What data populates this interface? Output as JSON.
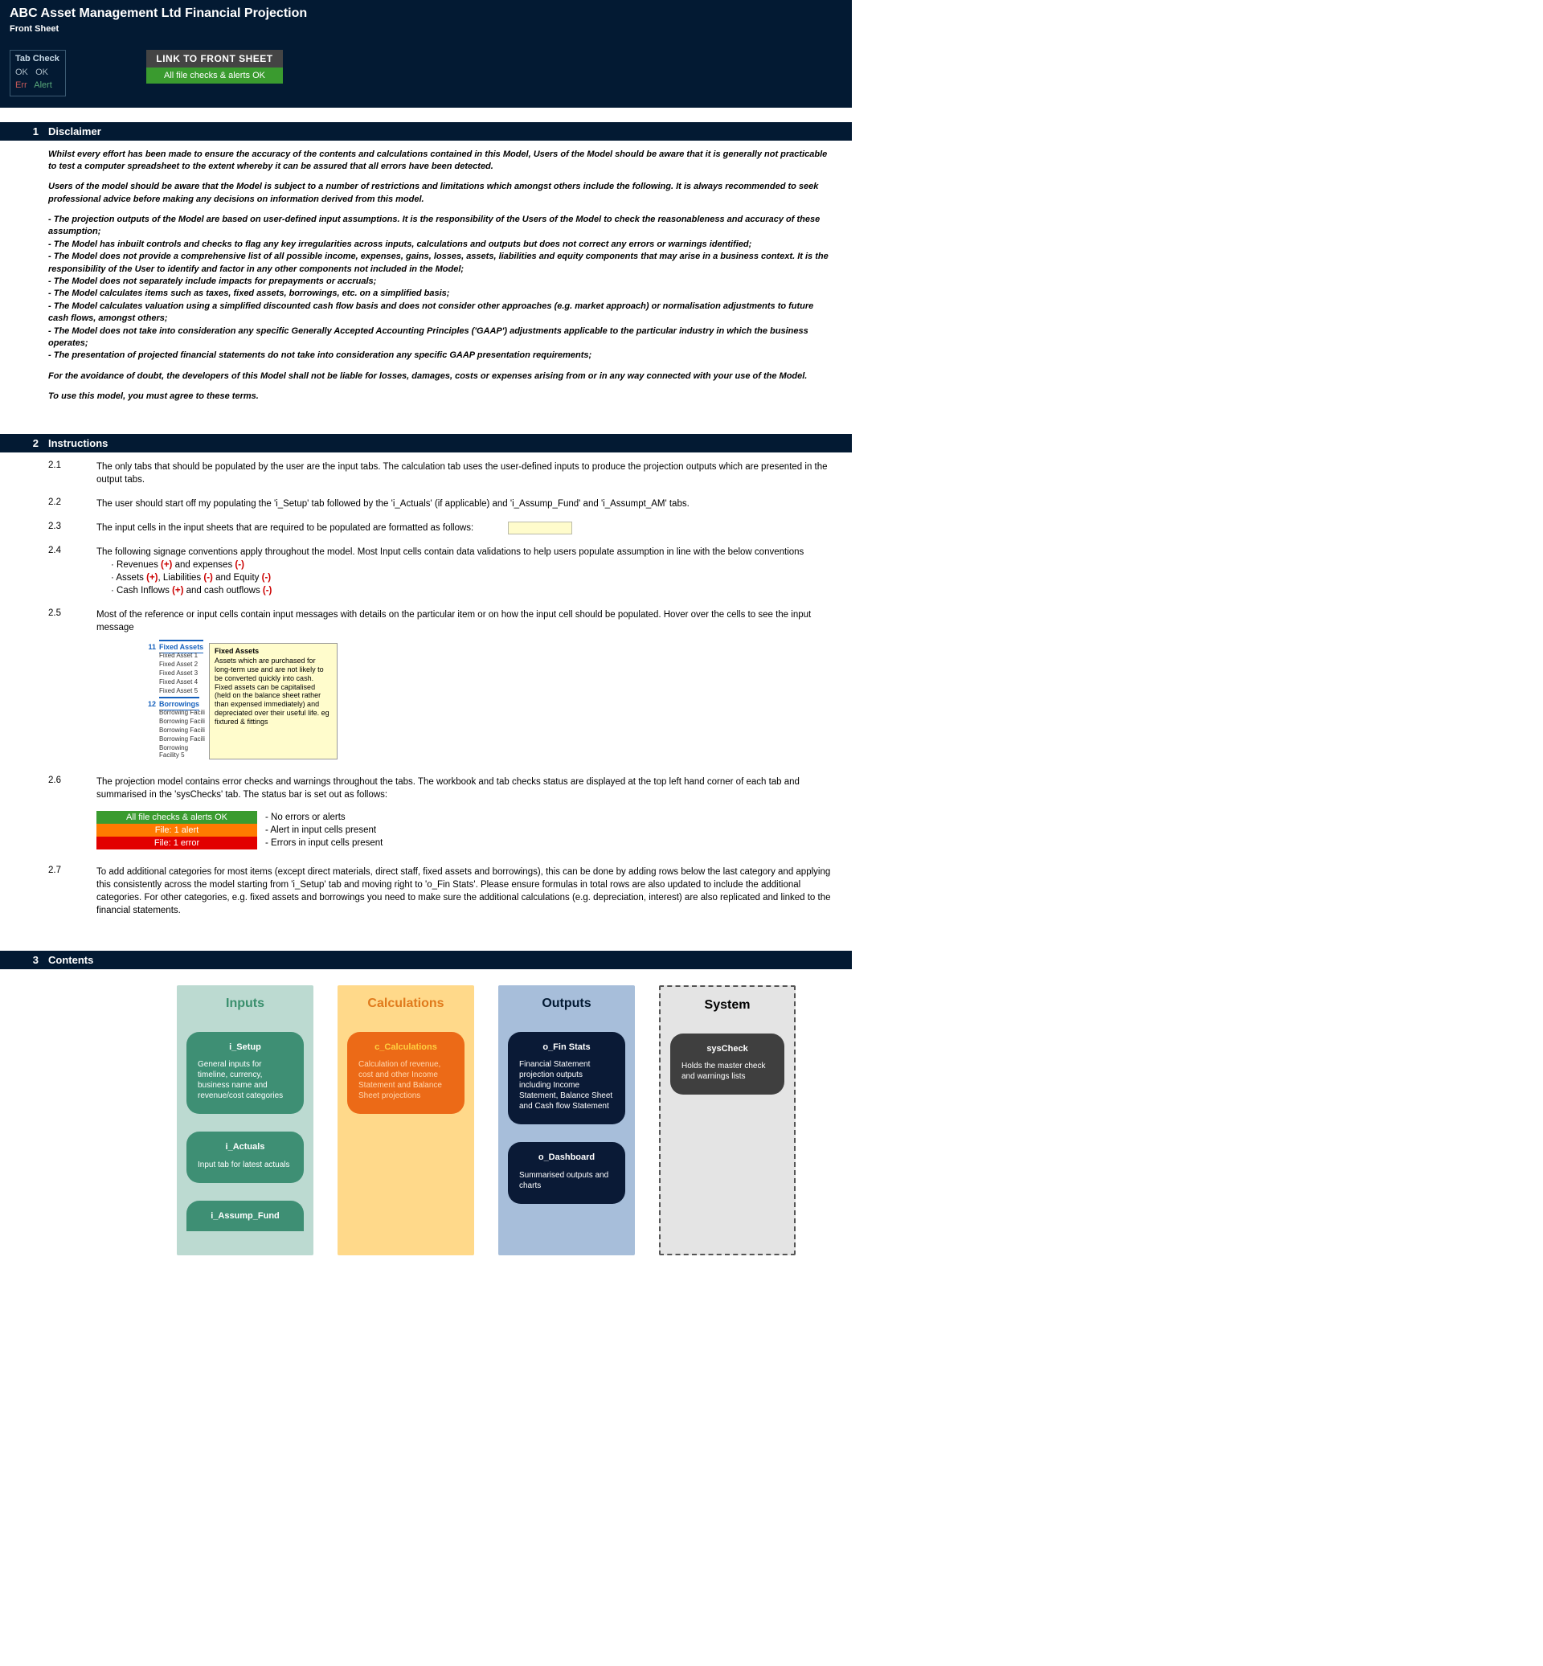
{
  "header": {
    "title": "ABC Asset Management Ltd Financial Projection",
    "subtitle": "Front Sheet",
    "tabcheck": {
      "title": "Tab Check",
      "line2a": "OK",
      "line2b": "OK",
      "line3a": "Err",
      "line3b": "Alert"
    },
    "linkbox": {
      "top": "LINK TO FRONT SHEET",
      "bottom": "All file checks & alerts OK"
    }
  },
  "sections": {
    "s1": {
      "num": "1",
      "title": "Disclaimer"
    },
    "s2": {
      "num": "2",
      "title": "Instructions"
    },
    "s3": {
      "num": "3",
      "title": "Contents"
    }
  },
  "disclaimer": {
    "p1": "Whilst every effort has been made to ensure the accuracy of the contents and calculations contained in this Model, Users of the Model should be aware that it is generally not practicable to test a computer spreadsheet to the extent whereby it can be assured that all errors have been detected.",
    "p2": "Users of the model should be aware that the Model is subject to a number of restrictions and limitations which amongst others include the following.  It is always recommended to seek professional advice before making any decisions on information derived from this model.",
    "b1": "- The projection outputs of the Model are based on user-defined input assumptions. It is the responsibility of the Users of the Model to check the reasonableness and accuracy of these assumption;",
    "b2": "- The Model has inbuilt controls and checks to flag any key irregularities across inputs, calculations and outputs but does not correct any errors or warnings identified;",
    "b3": "- The Model does not provide a comprehensive list of all possible income, expenses, gains, losses, assets, liabilities and equity components that may arise in a business context. It is the responsibility of the User to identify and factor in any other components not included in the Model;",
    "b4": "- The Model does not separately include impacts for prepayments or accruals;",
    "b5": "- The Model calculates items such as taxes, fixed assets, borrowings, etc. on a simplified basis;",
    "b6": "- The Model calculates valuation using a simplified discounted cash flow basis and does not consider other approaches (e.g. market approach) or normalisation adjustments to future cash flows, amongst others;",
    "b7": "- The Model does not take into consideration any specific Generally Accepted Accounting Principles ('GAAP') adjustments applicable to the particular industry in which the business operates;",
    "b8": "- The presentation of projected financial statements do not take into consideration any specific GAAP presentation requirements;",
    "p3": "For the avoidance of doubt, the developers of this Model shall not be liable for losses, damages, costs or expenses arising from or in any way connected with your use of the Model.",
    "p4": "To use this model, you must agree to these terms."
  },
  "instructions": {
    "i21": {
      "n": "2.1",
      "t": "The only tabs that should be populated by the user are the input tabs. The calculation tab uses the user-defined inputs to produce the projection outputs which are presented in the output tabs."
    },
    "i22": {
      "n": "2.2",
      "t": "The user should start off my populating the 'i_Setup' tab followed by the 'i_Actuals' (if applicable) and 'i_Assump_Fund' and 'i_Assumpt_AM' tabs."
    },
    "i23": {
      "n": "2.3",
      "t": "The input cells in the input sheets that are required to be populated are formatted as follows:"
    },
    "i24": {
      "n": "2.4",
      "t": "The following signage conventions apply throughout the model. Most Input cells contain data validations to help users populate assumption in line with the below conventions"
    },
    "sign": {
      "l1a": "Revenues ",
      "l1b": "(+)",
      "l1c": " and expenses ",
      "l1d": "(-)",
      "l2a": "Assets ",
      "l2b": "(+)",
      "l2c": ", Liabilities ",
      "l2d": "(-)",
      "l2e": " and Equity ",
      "l2f": "(-)",
      "l3a": "Cash Inflows ",
      "l3b": "(+)",
      "l3c": " and cash outflows ",
      "l3d": "(-)"
    },
    "i25": {
      "n": "2.5",
      "t": "Most of the reference or input cells contain input messages with details on the particular item or on how the input cell should be populated. Hover over the cells to see the input message"
    },
    "tooltip": {
      "n11": "11",
      "hdr1": "Fixed Assets",
      "fa1": "Fixed Asset 1",
      "fa2": "Fixed Asset 2",
      "fa3": "Fixed Asset 3",
      "fa4": "Fixed Asset 4",
      "fa5": "Fixed Asset 5",
      "n12": "12",
      "hdr2": "Borrowings",
      "bf1": "Borrowing Facili",
      "bf2": "Borrowing Facili",
      "bf3": "Borrowing Facili",
      "bf4": "Borrowing Facili",
      "bf5": "Borrowing Facility 5",
      "tiptitle": "Fixed Assets",
      "tipbody": "Assets which are purchased for long-term use and are not likely to be converted quickly into cash. Fixed assets can be capitalised (held on the balance sheet rather than expensed immediately) and depreciated over their useful life. eg fixtured & fittings"
    },
    "i26": {
      "n": "2.6",
      "t": "The projection model contains error checks and warnings throughout the tabs. The workbook and tab checks status are displayed at the top left hand corner of each tab and summarised in the 'sysChecks' tab. The status bar is set out as follows:"
    },
    "status": {
      "g": "All file checks & alerts OK",
      "gl": "- No errors or alerts",
      "o": "File: 1 alert",
      "ol": "- Alert in input cells present",
      "r": "File: 1 error",
      "rl": "- Errors in input cells present"
    },
    "i27": {
      "n": "2.7",
      "t": "To add additional categories for most items (except direct materials, direct staff, fixed assets and borrowings), this can be done by adding rows below the last category and applying this consistently across the model starting from 'i_Setup' tab and moving right to 'o_Fin Stats'. Please ensure formulas in total rows are also updated to include the additional categories. For other categories, e.g. fixed assets and borrowings you need to make sure the additional calculations (e.g. depreciation, interest) are also replicated and linked to the financial statements."
    }
  },
  "contents": {
    "inputs": {
      "title": "Inputs",
      "c1": {
        "t": "i_Setup",
        "d": "General inputs for timeline, currency, business name and revenue/cost categories"
      },
      "c2": {
        "t": "i_Actuals",
        "d": "Input tab for latest actuals"
      },
      "c3": {
        "t": "i_Assump_Fund"
      }
    },
    "calc": {
      "title": "Calculations",
      "c1": {
        "t": "c_Calculations",
        "d": "Calculation of revenue, cost and other Income Statement and Balance Sheet projections"
      }
    },
    "outputs": {
      "title": "Outputs",
      "c1": {
        "t": "o_Fin Stats",
        "d": "Financial Statement projection outputs including Income Statement, Balance Sheet and Cash flow Statement"
      },
      "c2": {
        "t": "o_Dashboard",
        "d": "Summarised outputs and charts"
      }
    },
    "system": {
      "title": "System",
      "c1": {
        "t": "sysCheck",
        "d": "Holds the master check and warnings lists"
      }
    }
  }
}
